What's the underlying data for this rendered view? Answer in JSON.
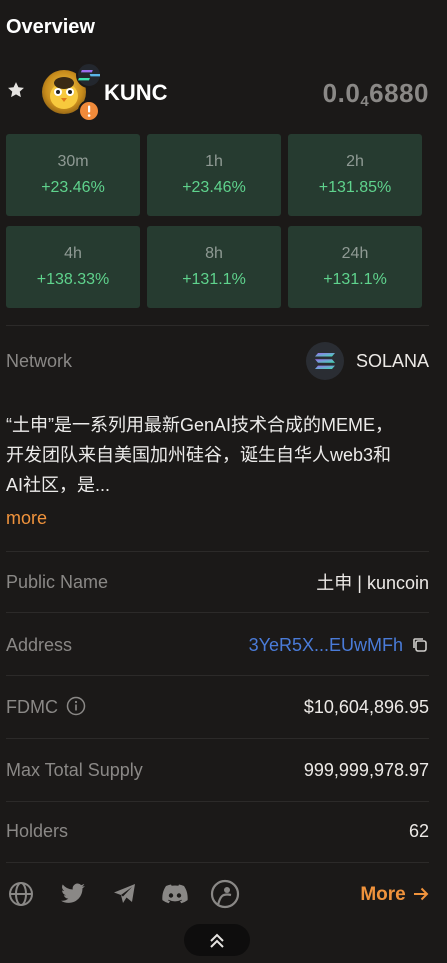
{
  "header": {
    "title": "Overview"
  },
  "token": {
    "symbol": "KUNC",
    "price_prefix": "0.0",
    "price_sub": "4",
    "price_suffix": "6880"
  },
  "changes": [
    {
      "period": "30m",
      "value": "+23.46%"
    },
    {
      "period": "1h",
      "value": "+23.46%"
    },
    {
      "period": "2h",
      "value": "+131.85%"
    },
    {
      "period": "4h",
      "value": "+138.33%"
    },
    {
      "period": "8h",
      "value": "+131.1%"
    },
    {
      "period": "24h",
      "value": "+131.1%"
    }
  ],
  "network": {
    "label": "Network",
    "value": "SOLANA"
  },
  "description": {
    "line1": "“土申”是一系列用最新GenAI技术合成的MEME，",
    "line2": "开发团队来自美国加州硅谷，诞生自华人web3和",
    "line3": "AI社区，是...",
    "more_label": "more"
  },
  "details": {
    "public_name_label": "Public Name",
    "public_name_value": "土申 | kuncoin",
    "address_label": "Address",
    "address_value": "3YeR5X...EUwMFh",
    "fdmc_label": "FDMC",
    "fdmc_value": "$10,604,896.95",
    "supply_label": "Max Total Supply",
    "supply_value": "999,999,978.97",
    "holders_label": "Holders",
    "holders_value": "62"
  },
  "footer": {
    "more_label": "More"
  },
  "colors": {
    "background": "#1b1918",
    "positive": "#5fd38d",
    "cell_bg": "#263b30",
    "accent": "#f0933c",
    "link": "#4a7bd8"
  }
}
